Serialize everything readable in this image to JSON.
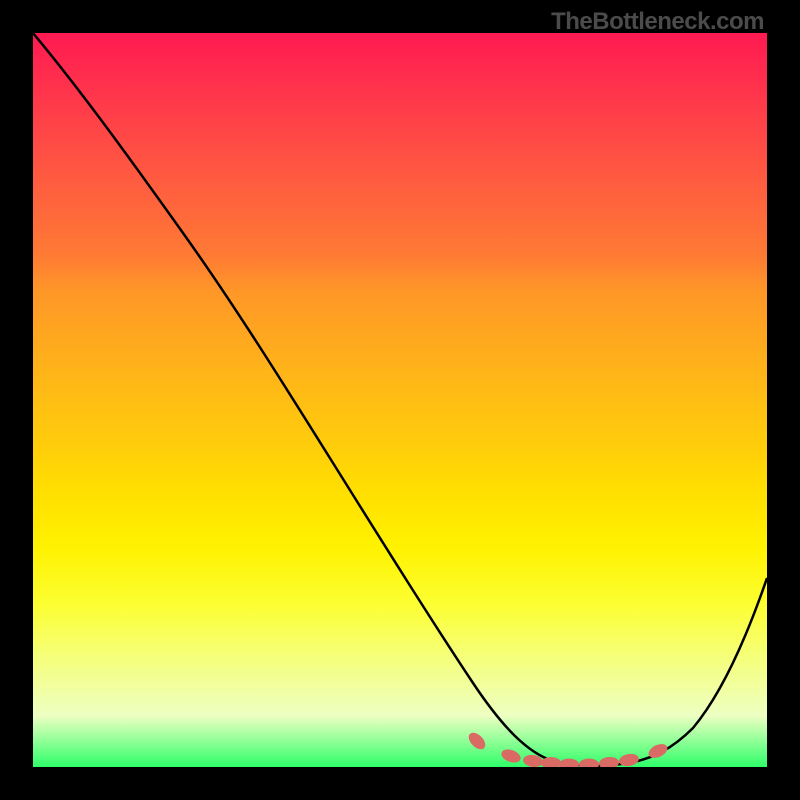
{
  "watermark": "TheBottleneck.com",
  "chart_data": {
    "type": "line",
    "title": "",
    "xlabel": "",
    "ylabel": "",
    "xlim": [
      0,
      100
    ],
    "ylim": [
      0,
      100
    ],
    "x": [
      0,
      10,
      20,
      30,
      40,
      50,
      55,
      60,
      65,
      67,
      70,
      72,
      75,
      78,
      80,
      85,
      90,
      95,
      100
    ],
    "values": [
      100,
      93,
      80,
      67,
      53,
      40,
      33,
      25,
      15,
      10,
      6,
      3,
      1,
      0,
      0,
      1,
      5,
      13,
      26
    ],
    "marker_points_x": [
      61,
      66,
      69,
      71,
      73,
      76,
      79,
      82,
      85
    ],
    "marker_points_y": [
      3,
      1.5,
      1,
      0.8,
      0.7,
      0.7,
      0.8,
      1,
      2
    ],
    "marker_shape": "pill",
    "marker_color": "#d96b64",
    "line_color": "#000000",
    "background_gradient": [
      "#ff1a52",
      "#ffe000",
      "#2eff69"
    ]
  }
}
